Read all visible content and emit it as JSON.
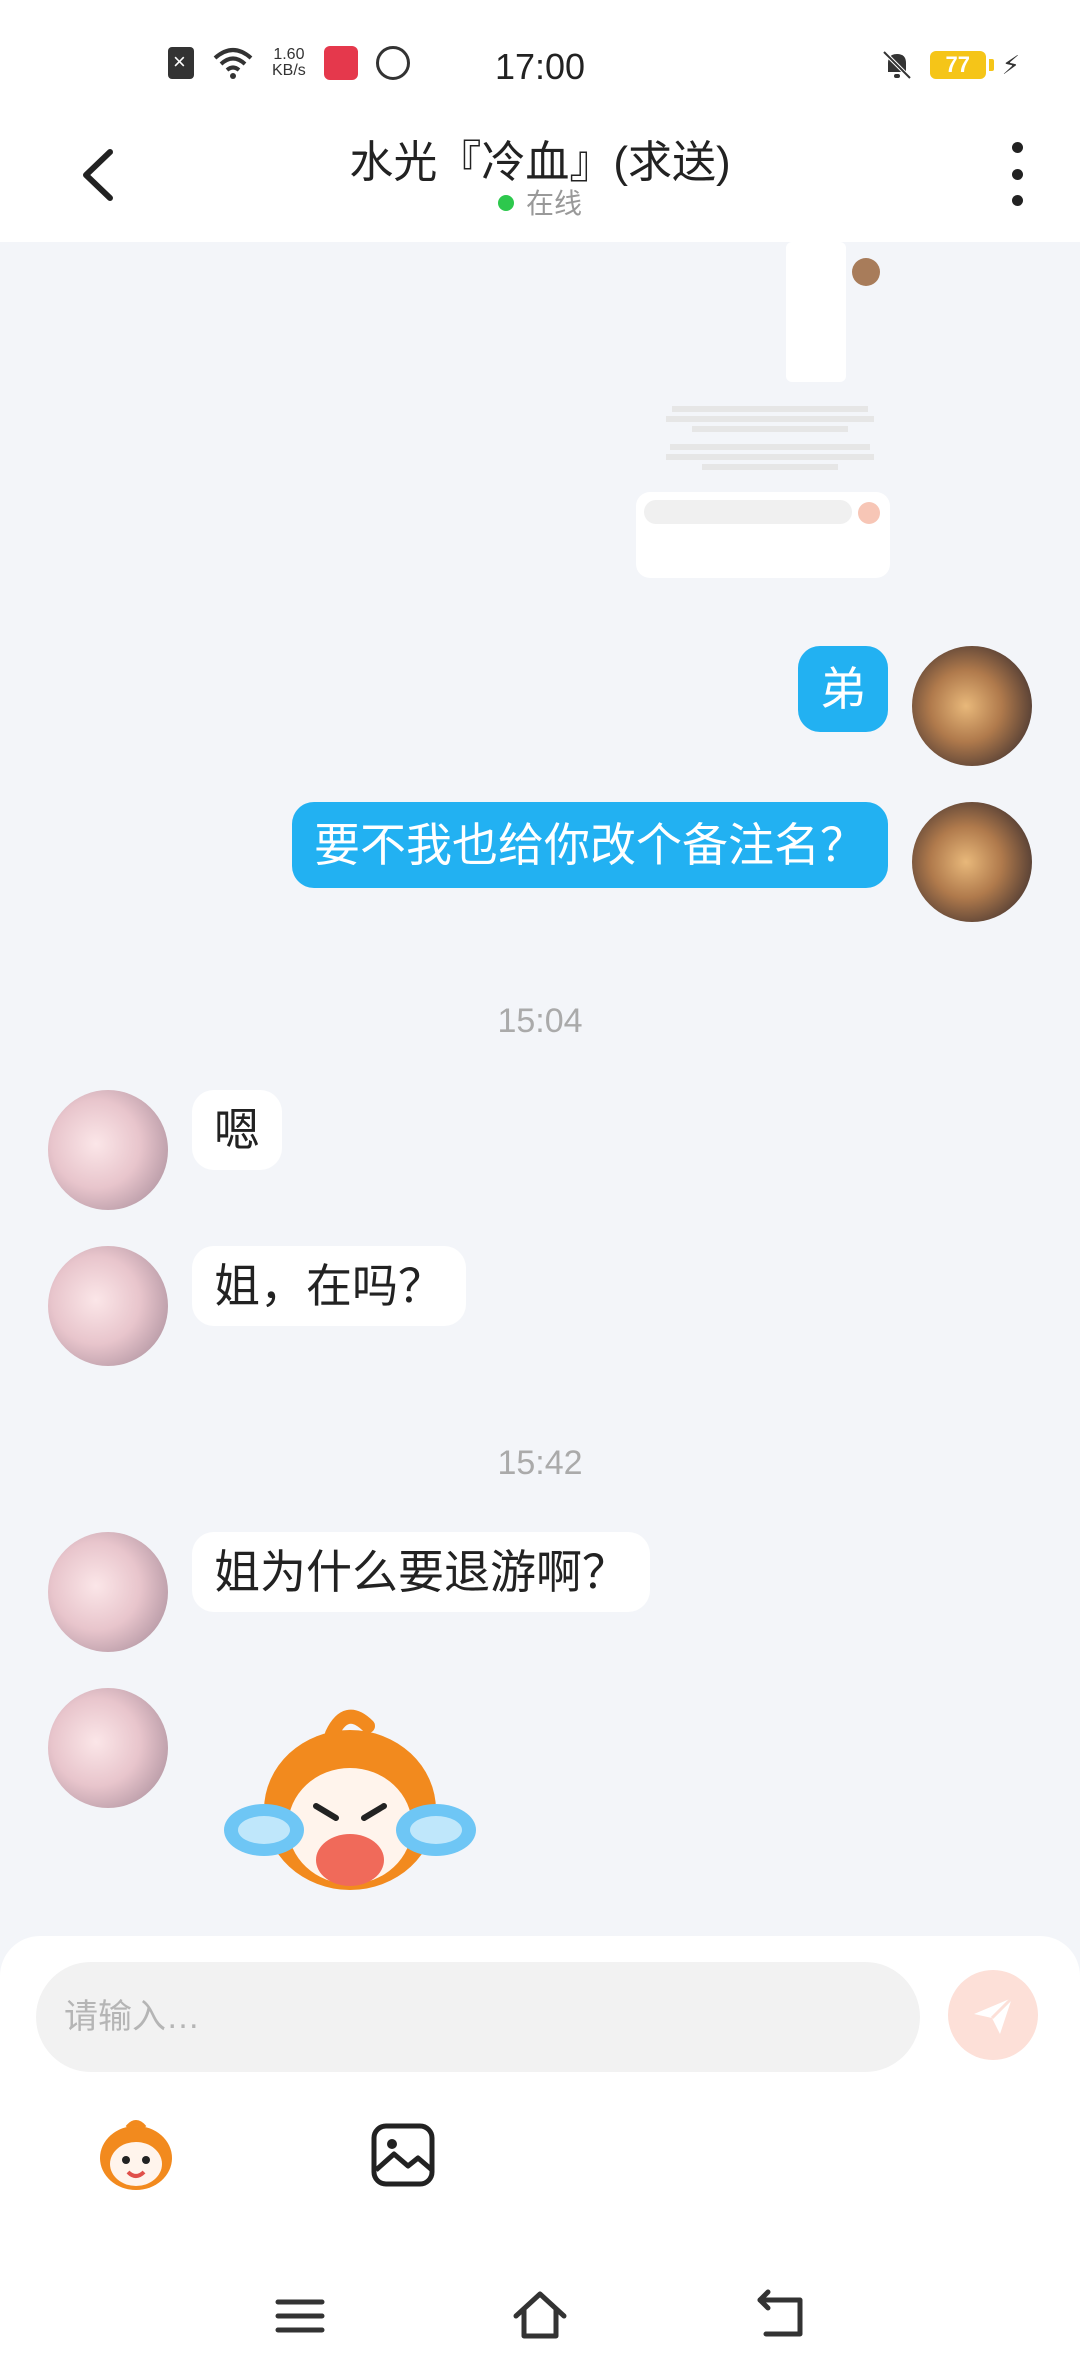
{
  "status_bar": {
    "time": "17:00",
    "net_speed_value": "1.60",
    "net_speed_unit": "KB/s",
    "battery": "77",
    "icons": [
      "sim-off-icon",
      "wifi-icon",
      "app-notification-icon",
      "circle-status-icon",
      "mute-bell-icon",
      "battery-icon",
      "charging-bolt-icon"
    ],
    "colors": {
      "battery": "#f5c518"
    }
  },
  "header": {
    "title": "水光『冷血』(求送)",
    "status": "在线",
    "icons": [
      "back-arrow-icon",
      "more-vertical-icon"
    ],
    "colors": {
      "online_dot": "#2dc84d"
    }
  },
  "messages": [
    {
      "from": "self",
      "type": "image",
      "content": "shared-screenshot"
    },
    {
      "from": "self",
      "type": "text",
      "text": "弟"
    },
    {
      "from": "self",
      "type": "text",
      "text": "要不我也给你改个备注名？"
    },
    {
      "type": "time",
      "text": "15:04"
    },
    {
      "from": "peer",
      "type": "text",
      "text": "嗯"
    },
    {
      "from": "peer",
      "type": "text",
      "text": "姐，在吗？"
    },
    {
      "type": "time",
      "text": "15:42"
    },
    {
      "from": "peer",
      "type": "text",
      "text": "姐为什么要退游啊？"
    },
    {
      "from": "peer",
      "type": "sticker",
      "content": "crying-sticker"
    }
  ],
  "input": {
    "placeholder": "请输入…",
    "value": ""
  },
  "toolbar": {
    "icons": [
      "emoji-sticker-icon",
      "image-icon",
      "send-icon"
    ]
  },
  "nav_bar": {
    "icons": [
      "menu-icon",
      "home-icon",
      "back-icon"
    ]
  },
  "colors": {
    "outgoing_bubble": "#22b1f2",
    "incoming_bubble": "#ffffff",
    "chat_background": "#f3f5f9",
    "send_button": "#fde0d8"
  }
}
